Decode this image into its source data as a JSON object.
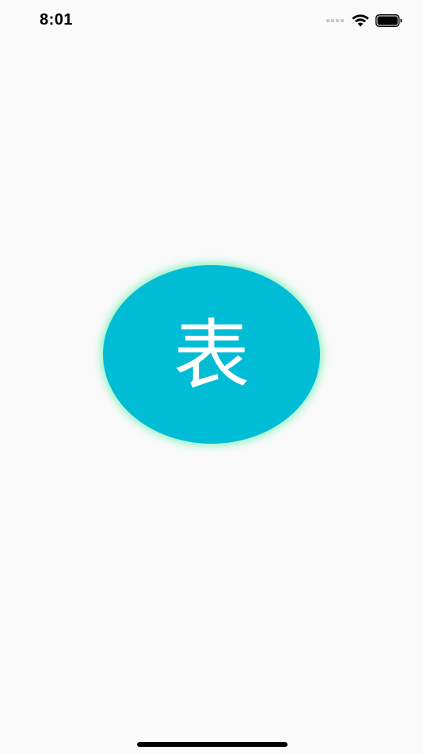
{
  "status_bar": {
    "time": "8:01",
    "icons": [
      "signal-icon",
      "wifi-icon",
      "battery-icon"
    ]
  },
  "main": {
    "button_label": "表",
    "colors": {
      "button_fill": "#00bcd4",
      "button_glow": "#69f0ae",
      "label": "#ffffff",
      "background": "#fafafa"
    }
  }
}
